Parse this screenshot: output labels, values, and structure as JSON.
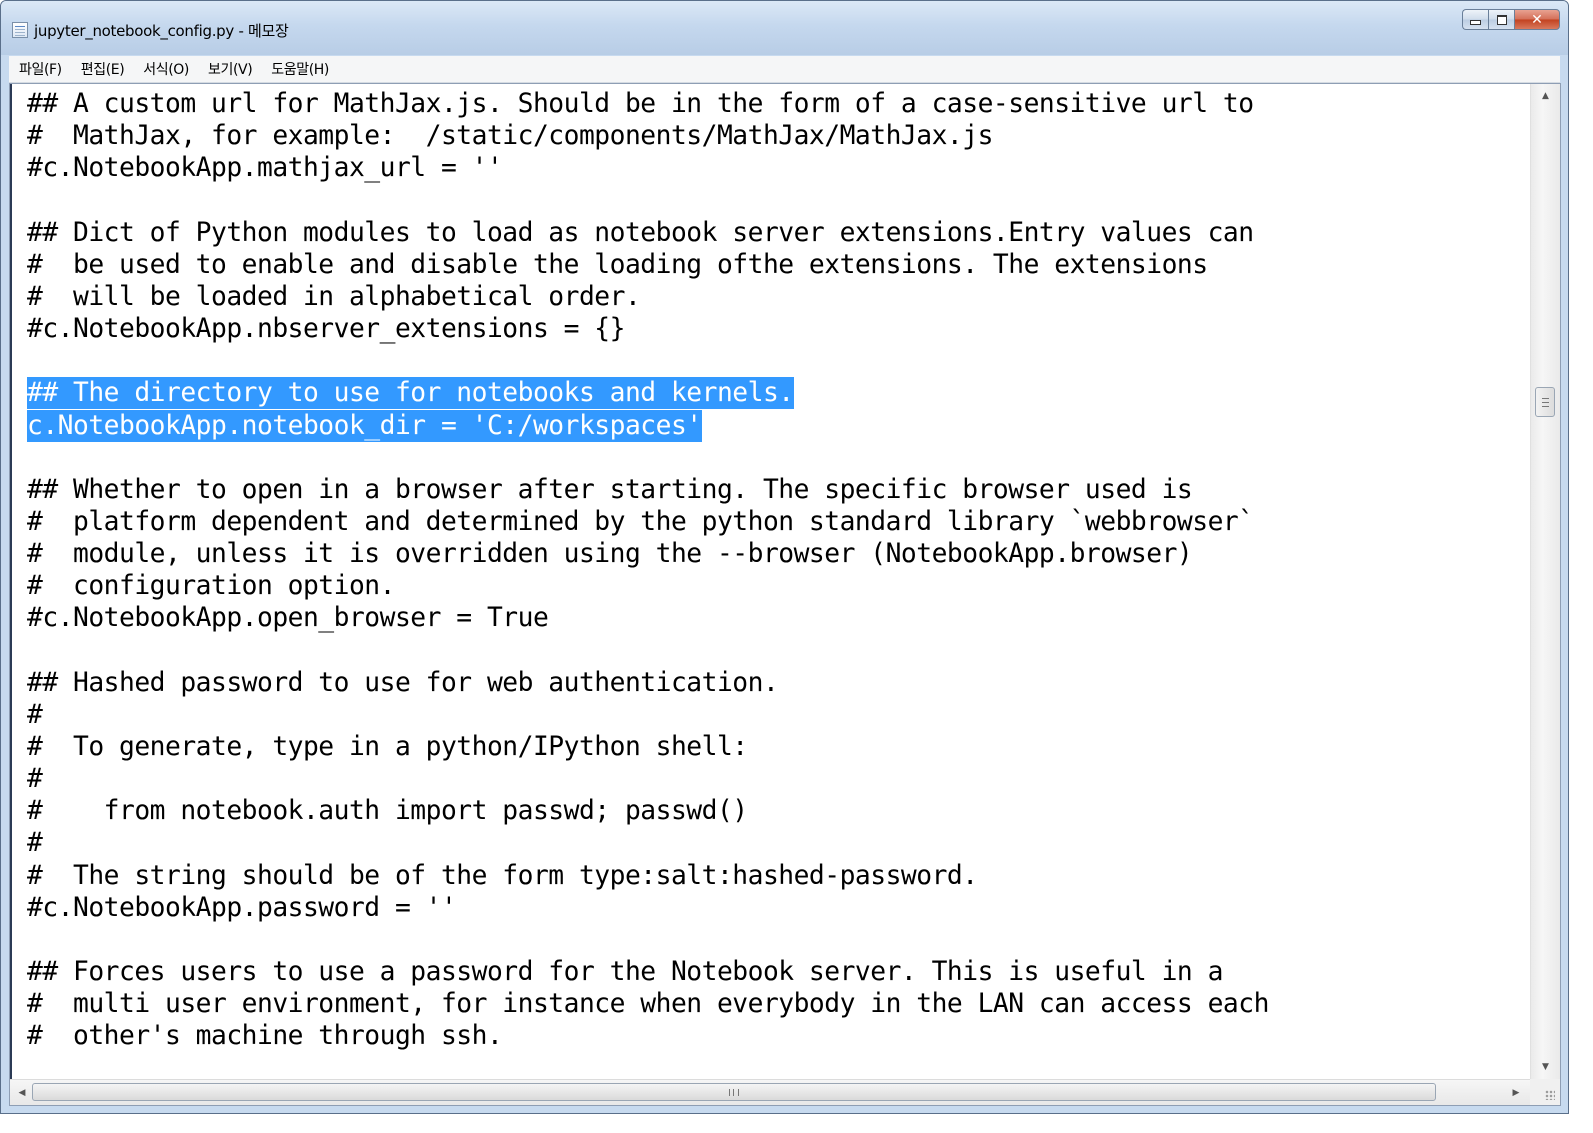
{
  "window": {
    "title": "jupyter_notebook_config.py - 메모장"
  },
  "menu": [
    {
      "label": "파일(F)"
    },
    {
      "label": "편집(E)"
    },
    {
      "label": "서식(O)"
    },
    {
      "label": "보기(V)"
    },
    {
      "label": "도움말(H)"
    }
  ],
  "editor": {
    "lines": [
      "## A custom url for MathJax.js. Should be in the form of a case-sensitive url to",
      "#  MathJax, for example:  /static/components/MathJax/MathJax.js",
      "#c.NotebookApp.mathjax_url = ''",
      "",
      "## Dict of Python modules to load as notebook server extensions.Entry values can",
      "#  be used to enable and disable the loading ofthe extensions. The extensions",
      "#  will be loaded in alphabetical order.",
      "#c.NotebookApp.nbserver_extensions = {}",
      "",
      "## The directory to use for notebooks and kernels.",
      "c.NotebookApp.notebook_dir = 'C:/workspaces'",
      "",
      "## Whether to open in a browser after starting. The specific browser used is",
      "#  platform dependent and determined by the python standard library `webbrowser`",
      "#  module, unless it is overridden using the --browser (NotebookApp.browser)",
      "#  configuration option.",
      "#c.NotebookApp.open_browser = True",
      "",
      "## Hashed password to use for web authentication.",
      "#",
      "#  To generate, type in a python/IPython shell:",
      "#",
      "#    from notebook.auth import passwd; passwd()",
      "#",
      "#  The string should be of the form type:salt:hashed-password.",
      "#c.NotebookApp.password = ''",
      "",
      "## Forces users to use a password for the Notebook server. This is useful in a",
      "#  multi user environment, for instance when everybody in the LAN can access each",
      "#  other's machine through ssh."
    ],
    "selected_lines": [
      9,
      10
    ]
  },
  "colors": {
    "selection": "#3399ff",
    "title_bar": "#c7daef",
    "close_button": "#c2411f"
  },
  "icons": {
    "app": "notepad-icon",
    "minimize": "minimize-icon",
    "maximize": "maximize-icon",
    "close": "close-icon"
  }
}
